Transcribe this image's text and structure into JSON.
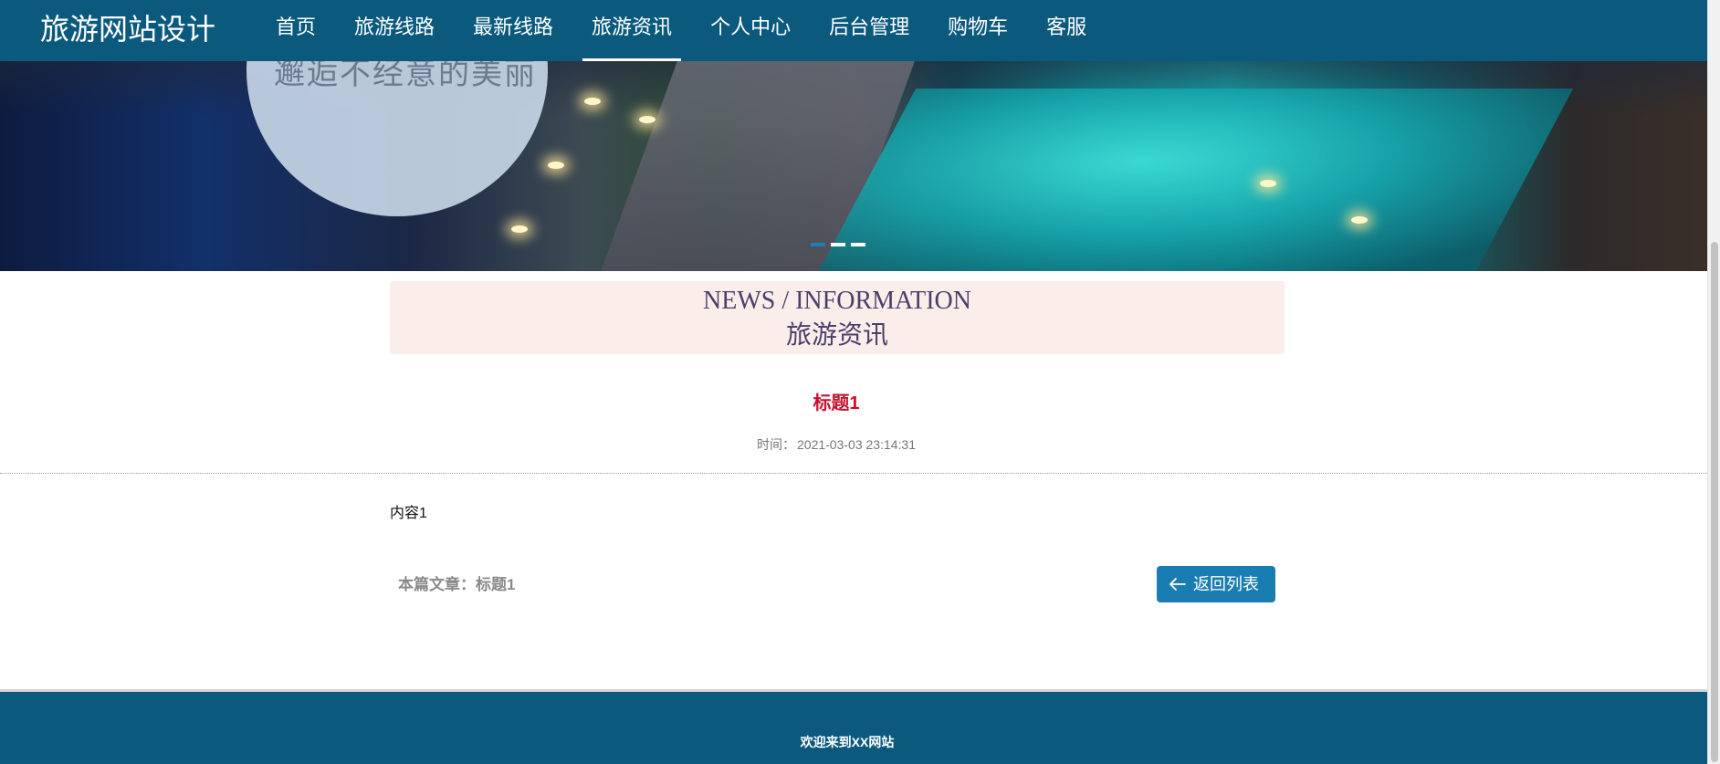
{
  "header": {
    "brand": "旅游网站设计",
    "nav": [
      {
        "label": "首页"
      },
      {
        "label": "旅游线路"
      },
      {
        "label": "最新线路"
      },
      {
        "label": "旅游资讯",
        "active": true
      },
      {
        "label": "个人中心"
      },
      {
        "label": "后台管理"
      },
      {
        "label": "购物车"
      },
      {
        "label": "客服"
      }
    ]
  },
  "banner": {
    "slogan": "邂逅不经意的美丽",
    "slide_count": 3,
    "active_slide": 1
  },
  "section": {
    "title_en": "NEWS / INFORMATION",
    "title_cn": "旅游资讯"
  },
  "article": {
    "title": "标题1",
    "time_label": "时间：",
    "time_value": "2021-03-03 23:14:31",
    "content": "内容1",
    "current_label": "本篇文章：",
    "current_title": "标题1",
    "back_label": "返回列表"
  },
  "footer": {
    "text": "欢迎来到XX网站"
  },
  "colors": {
    "header_bg": "#0b5a7e",
    "title_red": "#c8102e",
    "button_blue": "#1a7db2",
    "section_bg": "#fbeeea"
  },
  "icons": {
    "back": "arrow-left-icon"
  }
}
